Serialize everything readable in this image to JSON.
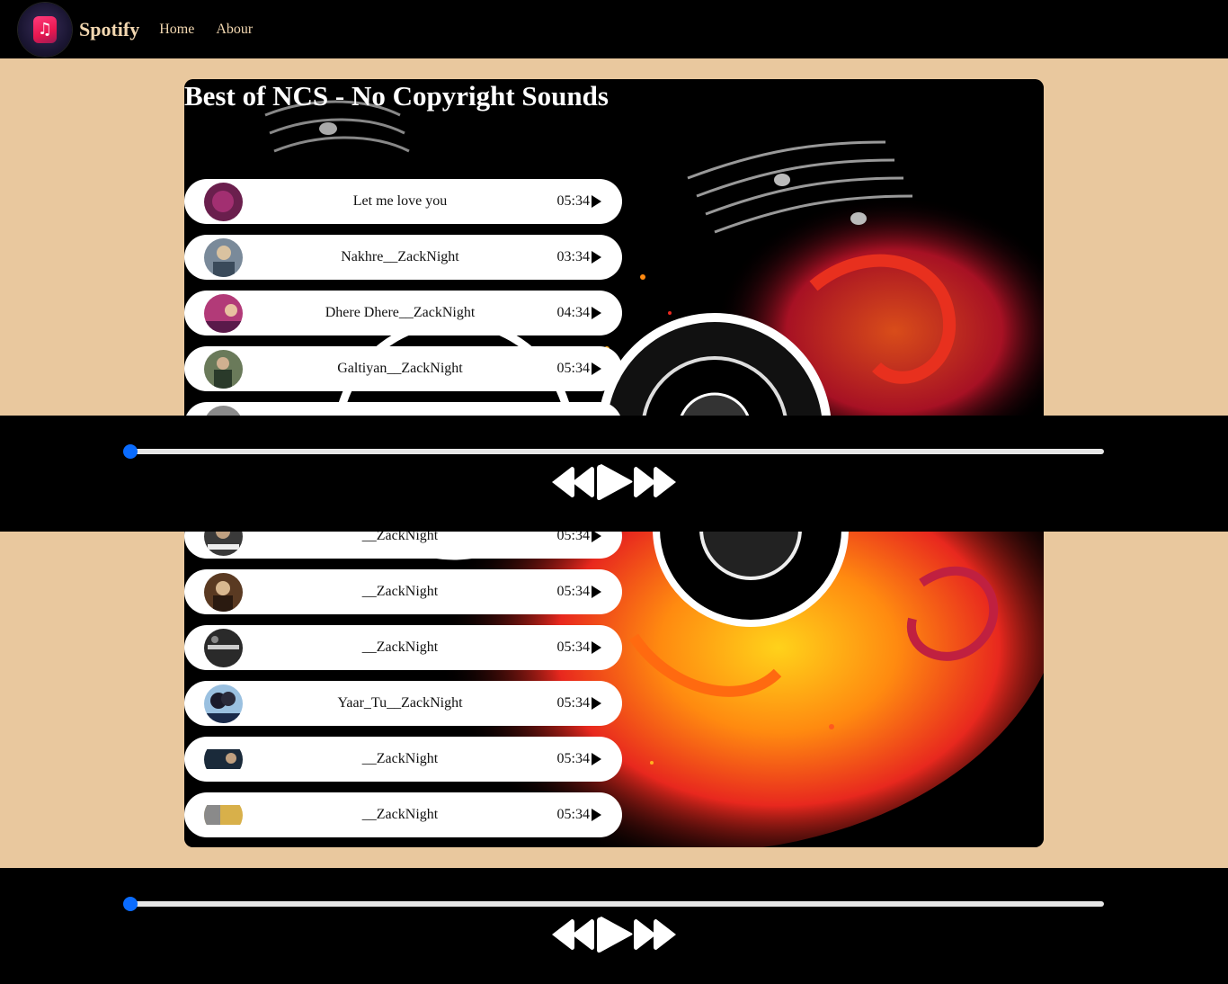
{
  "navbar": {
    "brand": "Spotify",
    "links": [
      "Home",
      "Abour"
    ],
    "logo_icon": "music-note-icon"
  },
  "playlist": {
    "title": "Best of NCS - No Copyright Sounds",
    "songs": [
      {
        "name": "Let me love you",
        "duration": "05:34",
        "cover_color": "#6a1f4d"
      },
      {
        "name": "Nakhre__ZackNight",
        "duration": "03:34",
        "cover_color": "#7a8a9a"
      },
      {
        "name": "Dhere Dhere__ZackNight",
        "duration": "04:34",
        "cover_color": "#b23a78"
      },
      {
        "name": "Galtiyan__ZackNight",
        "duration": "05:34",
        "cover_color": "#4d5a3a"
      },
      {
        "name": "",
        "duration": "",
        "cover_color": "#8a8a8a"
      },
      {
        "name": "",
        "duration": "",
        "cover_color": "#5a3a2a"
      },
      {
        "name": "__ZackNight",
        "duration": "05:34",
        "cover_color": "#3a3a3a"
      },
      {
        "name": "__ZackNight",
        "duration": "05:34",
        "cover_color": "#5a3a22"
      },
      {
        "name": "__ZackNight",
        "duration": "05:34",
        "cover_color": "#2a2a2a"
      },
      {
        "name": "Yaar_Tu__ZackNight",
        "duration": "05:34",
        "cover_color": "#3a6a9a"
      },
      {
        "name": "__ZackNight",
        "duration": "05:34",
        "cover_color": "#1a2a3a"
      },
      {
        "name": "__ZackNight",
        "duration": "05:34",
        "cover_color": "#d8b04a"
      }
    ]
  },
  "player": {
    "progress": 0,
    "accent_color": "#0a6cff",
    "controls": [
      "previous-icon",
      "play-icon",
      "next-icon"
    ]
  }
}
